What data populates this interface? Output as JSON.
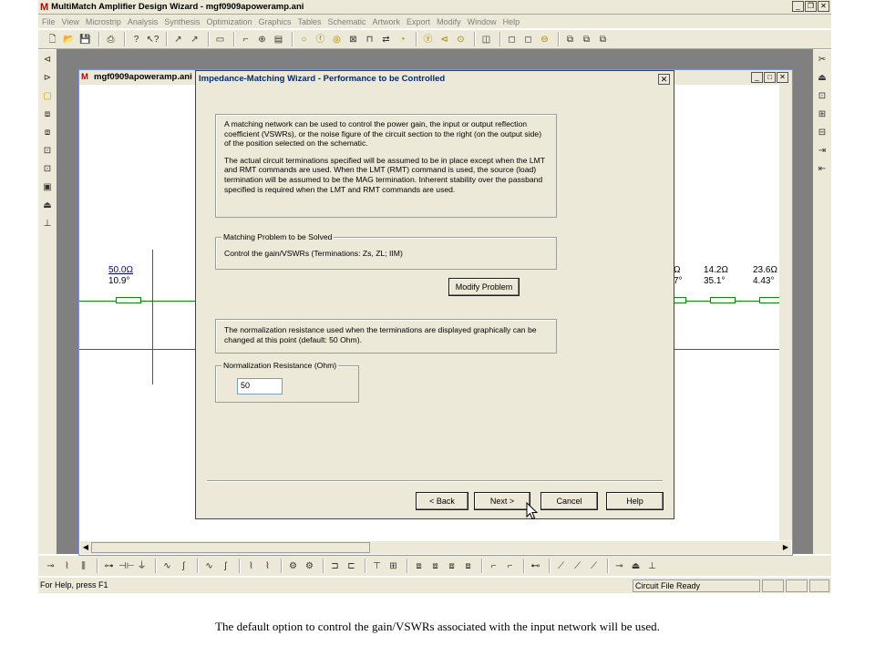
{
  "app": {
    "title": "MultiMatch Amplifier Design Wizard - mgf0909apoweramp.ani",
    "logo": "M"
  },
  "menu": [
    "File",
    "View",
    "Microstrip",
    "Analysis",
    "Synthesis",
    "Optimization",
    "Graphics",
    "Tables",
    "Schematic",
    "Artwork",
    "Export",
    "Modify",
    "Window",
    "Help"
  ],
  "toolbar_icons": [
    "new-icon",
    "open-icon",
    "save-icon",
    "print-icon",
    "help-icon",
    "context-help-icon",
    "arrow-icon",
    "arrow-2-icon",
    "component-icon",
    "probe-icon",
    "node-icon",
    "edit-icon",
    "circle-icon",
    "circle-f-icon",
    "circle-dot-icon",
    "cross-box-icon",
    "bridge-icon",
    "swap-icon",
    "graph-icon",
    "y-icon",
    "chevron-circle-icon",
    "dot-circle-icon",
    "chart-icon",
    "square-icon",
    "square-2-icon",
    "minus-circle-icon",
    "stack-icon",
    "stack-2-icon",
    "stack-3-icon"
  ],
  "child_window": {
    "title": "mgf0909apoweramp.ani"
  },
  "schematic": {
    "left_label_1": "50.0Ω",
    "left_label_2": "10.9°",
    "r1_label_1": "Ω",
    "r1_label_2": "7°",
    "r2_label_1": "14.2Ω",
    "r2_label_2": "35.1°",
    "r3_label_1": "23.6Ω",
    "r3_label_2": "4.43°"
  },
  "dialog": {
    "title": "Impedance-Matching Wizard - Performance to be Controlled",
    "close": "✕",
    "intro_p1": "A matching network can be used to control the power gain, the input or output reflection coefficient (VSWRs), or the noise figure of the circuit section to the right (on the output side) of the position selected on the schematic.",
    "intro_p2": "The actual circuit terminations specified will be assumed to be in place except when the LMT and RMT commands are used. When the LMT (RMT) command is used, the source (load) termination will be assumed to be the MAG  termination. Inherent stability over the passband specified is required when the LMT and RMT commands are used.",
    "problem_legend": "Matching Problem to be Solved",
    "problem_text": "Control the gain/VSWRs (Terminations: Zs, ZL; IIM)",
    "modify_button": "Modify Problem",
    "norm_text": "The normalization resistance used when the terminations are displayed graphically can be changed at this point (default: 50 Ohm).",
    "norm_legend": "Normalization Resistance (Ohm)",
    "norm_value": "50",
    "back_button": "< Back",
    "next_button": "Next >",
    "cancel_button": "Cancel",
    "help_button": "Help"
  },
  "status": {
    "help_text": "For Help, press F1",
    "circuit_status": "Circuit File Ready"
  },
  "caption": "The default option to control the gain/VSWRs associated with the input network will be used."
}
